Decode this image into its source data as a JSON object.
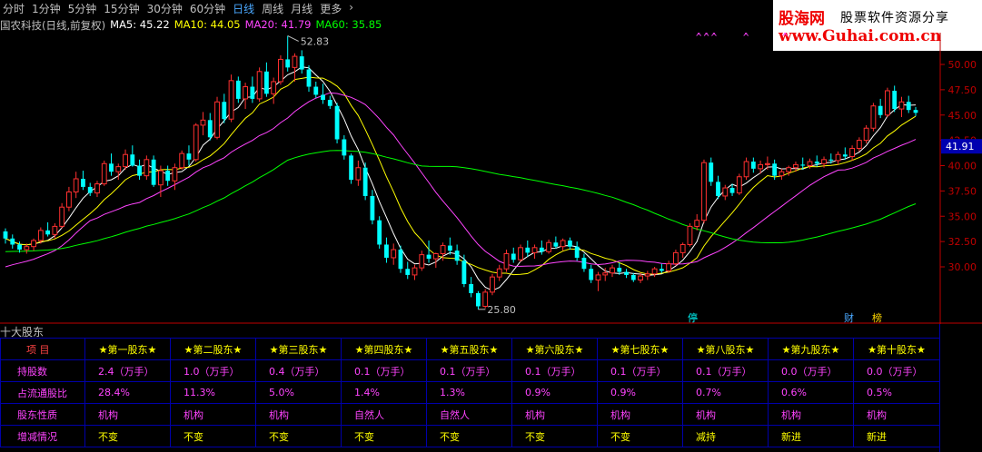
{
  "tabs": [
    "分时",
    "1分钟",
    "5分钟",
    "15分钟",
    "30分钟",
    "60分钟",
    "日线",
    "周线",
    "月线",
    "更多"
  ],
  "active_tab": "日线",
  "more_arrow": "›",
  "indicator": {
    "title": "国农科技(日线,前复权)",
    "ma": [
      {
        "label": "MA5: 45.22",
        "color": "#ffffff"
      },
      {
        "label": "MA10: 44.05",
        "color": "#ffff00"
      },
      {
        "label": "MA20: 41.79",
        "color": "#ff44ff"
      },
      {
        "label": "MA60: 35.85",
        "color": "#00ff00"
      }
    ]
  },
  "logo": {
    "line1": "股海网",
    "line1b": "股票软件资源分享",
    "line2": "www.Guhai.com.cn"
  },
  "section_title": "十大股东",
  "holders_table": {
    "header": [
      "项  目",
      "★第一股东★",
      "★第二股东★",
      "★第三股东★",
      "★第四股东★",
      "★第五股东★",
      "★第六股东★",
      "★第七股东★",
      "★第八股东★",
      "★第九股东★",
      "★第十股东★"
    ],
    "rows": [
      {
        "label": "持股数",
        "cells": [
          "2.4（万手）",
          "1.0（万手）",
          "0.4（万手）",
          "0.1（万手）",
          "0.1（万手）",
          "0.1（万手）",
          "0.1（万手）",
          "0.1（万手）",
          "0.0（万手）",
          "0.0（万手）"
        ]
      },
      {
        "label": "占流通股比",
        "cells": [
          "28.4%",
          "11.3%",
          "5.0%",
          "1.4%",
          "1.3%",
          "0.9%",
          "0.9%",
          "0.7%",
          "0.6%",
          "0.5%"
        ]
      },
      {
        "label": "股东性质",
        "cells": [
          "机构",
          "机构",
          "机构",
          "自然人",
          "自然人",
          "机构",
          "机构",
          "机构",
          "机构",
          "机构"
        ]
      },
      {
        "label": "增减情况",
        "cells": [
          "不变",
          "不变",
          "不变",
          "不变",
          "不变",
          "不变",
          "不变",
          "减持",
          "新进",
          "新进"
        ]
      }
    ]
  },
  "chart_data": {
    "type": "candlestick",
    "ylim": [
      25,
      53
    ],
    "y_ticks": [
      "50.00",
      "47.50",
      "45.00",
      "42.50",
      "40.00",
      "37.50",
      "35.00",
      "32.50",
      "30.00"
    ],
    "y_tick_values": [
      50,
      47.5,
      45,
      42.5,
      40,
      37.5,
      35,
      32.5,
      30
    ],
    "current_price": "41.91",
    "current_price_value": 41.91,
    "annotations": {
      "high_label": "52.83",
      "high_value": 52.83,
      "low_label": "25.80",
      "low_value": 25.8
    },
    "markers": {
      "top_marks": [
        "××× ",
        "×",
        "×"
      ],
      "bottom_marks": [
        "停",
        "财",
        "榜"
      ]
    },
    "ohlc": [
      [
        33.5,
        33.8,
        32.3,
        32.8
      ],
      [
        32.8,
        33.2,
        31.8,
        32.2
      ],
      [
        32.2,
        32.5,
        31.4,
        31.7
      ],
      [
        31.7,
        32.3,
        31.3,
        32.0
      ],
      [
        32.0,
        32.8,
        31.6,
        32.6
      ],
      [
        32.6,
        33.9,
        32.3,
        33.6
      ],
      [
        33.6,
        34.4,
        33.0,
        33.2
      ],
      [
        33.2,
        34.3,
        32.8,
        34.0
      ],
      [
        34.0,
        36.3,
        33.8,
        35.9
      ],
      [
        35.9,
        37.9,
        35.5,
        37.4
      ],
      [
        37.4,
        39.4,
        36.8,
        38.7
      ],
      [
        38.7,
        39.5,
        37.6,
        37.9
      ],
      [
        37.9,
        38.3,
        37.0,
        37.3
      ],
      [
        37.3,
        38.5,
        36.9,
        38.2
      ],
      [
        38.2,
        40.5,
        38.0,
        40.2
      ],
      [
        40.2,
        41.2,
        39.0,
        39.4
      ],
      [
        39.4,
        40.2,
        38.6,
        39.9
      ],
      [
        39.9,
        41.6,
        39.6,
        41.1
      ],
      [
        41.1,
        42.0,
        39.9,
        40.0
      ],
      [
        40.0,
        40.6,
        38.6,
        39.0
      ],
      [
        39.0,
        41.0,
        38.6,
        40.6
      ],
      [
        40.6,
        41.0,
        37.9,
        38.1
      ],
      [
        38.1,
        40.0,
        36.9,
        39.5
      ],
      [
        39.5,
        40.0,
        38.0,
        38.5
      ],
      [
        38.5,
        40.2,
        37.6,
        39.8
      ],
      [
        39.8,
        41.5,
        39.6,
        41.2
      ],
      [
        41.2,
        42.0,
        40.0,
        40.6
      ],
      [
        40.6,
        44.2,
        40.4,
        44.0
      ],
      [
        44.0,
        45.3,
        43.0,
        44.5
      ],
      [
        44.5,
        45.2,
        42.5,
        42.8
      ],
      [
        42.8,
        46.8,
        42.6,
        46.3
      ],
      [
        46.3,
        47.1,
        44.2,
        44.6
      ],
      [
        44.6,
        49.0,
        44.3,
        48.4
      ],
      [
        48.4,
        48.8,
        46.2,
        46.6
      ],
      [
        46.6,
        48.2,
        45.6,
        47.8
      ],
      [
        47.8,
        48.8,
        46.2,
        46.6
      ],
      [
        46.6,
        49.7,
        46.3,
        49.3
      ],
      [
        49.3,
        50.2,
        46.8,
        47.1
      ],
      [
        47.1,
        48.7,
        46.1,
        48.3
      ],
      [
        48.3,
        50.9,
        48.0,
        50.5
      ],
      [
        50.5,
        52.83,
        49.3,
        49.7
      ],
      [
        49.7,
        51.1,
        48.3,
        50.8
      ],
      [
        50.8,
        51.4,
        49.1,
        49.5
      ],
      [
        49.5,
        49.9,
        47.3,
        47.8
      ],
      [
        47.8,
        48.3,
        46.7,
        47.0
      ],
      [
        47.0,
        48.1,
        46.1,
        46.5
      ],
      [
        46.5,
        46.9,
        45.6,
        45.9
      ],
      [
        45.9,
        46.2,
        42.2,
        42.6
      ],
      [
        42.6,
        43.0,
        40.6,
        41.0
      ],
      [
        41.0,
        41.2,
        38.2,
        38.6
      ],
      [
        38.6,
        40.5,
        38.0,
        39.8
      ],
      [
        39.8,
        40.3,
        36.6,
        37.0
      ],
      [
        37.0,
        37.6,
        34.2,
        34.6
      ],
      [
        34.6,
        35.0,
        31.8,
        32.2
      ],
      [
        32.2,
        32.9,
        30.4,
        30.9
      ],
      [
        30.9,
        32.3,
        30.2,
        31.7
      ],
      [
        31.7,
        32.1,
        29.4,
        29.8
      ],
      [
        29.8,
        30.5,
        28.8,
        29.2
      ],
      [
        29.2,
        30.2,
        28.7,
        29.9
      ],
      [
        29.9,
        31.6,
        29.6,
        31.2
      ],
      [
        31.2,
        32.6,
        30.4,
        30.8
      ],
      [
        30.8,
        31.4,
        29.9,
        31.3
      ],
      [
        31.3,
        32.4,
        30.6,
        32.1
      ],
      [
        32.1,
        32.9,
        31.2,
        31.6
      ],
      [
        31.6,
        32.2,
        30.2,
        30.6
      ],
      [
        30.6,
        31.2,
        28.0,
        28.3
      ],
      [
        28.3,
        29.0,
        27.0,
        27.4
      ],
      [
        27.4,
        27.6,
        25.8,
        26.1
      ],
      [
        26.1,
        27.8,
        25.9,
        27.5
      ],
      [
        27.5,
        29.3,
        27.2,
        29.0
      ],
      [
        29.0,
        30.2,
        28.6,
        29.8
      ],
      [
        29.8,
        31.7,
        29.5,
        31.3
      ],
      [
        31.3,
        31.9,
        30.4,
        30.7
      ],
      [
        30.7,
        32.2,
        30.5,
        31.9
      ],
      [
        31.9,
        32.6,
        31.0,
        31.4
      ],
      [
        31.4,
        32.2,
        30.8,
        31.9
      ],
      [
        31.9,
        32.6,
        31.2,
        31.5
      ],
      [
        31.5,
        32.7,
        31.3,
        32.4
      ],
      [
        32.4,
        33.0,
        31.8,
        32.0
      ],
      [
        32.0,
        32.8,
        31.6,
        32.6
      ],
      [
        32.6,
        32.9,
        31.7,
        32.0
      ],
      [
        32.0,
        32.5,
        30.6,
        30.9
      ],
      [
        30.9,
        31.3,
        29.5,
        29.8
      ],
      [
        29.8,
        30.2,
        28.4,
        28.7
      ],
      [
        28.7,
        29.5,
        27.6,
        29.2
      ],
      [
        29.2,
        29.9,
        28.6,
        29.4
      ],
      [
        29.4,
        30.2,
        29.0,
        29.9
      ],
      [
        29.9,
        30.4,
        29.2,
        29.5
      ],
      [
        29.5,
        29.8,
        28.9,
        29.2
      ],
      [
        29.2,
        29.4,
        28.5,
        28.7
      ],
      [
        28.7,
        29.4,
        28.4,
        29.1
      ],
      [
        29.1,
        29.6,
        28.7,
        29.3
      ],
      [
        29.3,
        30.0,
        29.0,
        29.8
      ],
      [
        29.8,
        30.3,
        29.4,
        29.6
      ],
      [
        29.6,
        30.6,
        29.4,
        30.3
      ],
      [
        30.3,
        31.7,
        30.1,
        31.4
      ],
      [
        31.4,
        32.4,
        30.9,
        32.2
      ],
      [
        32.2,
        34.3,
        32.0,
        34.0
      ],
      [
        34.0,
        35.2,
        33.6,
        34.6
      ],
      [
        34.6,
        40.6,
        34.3,
        40.3
      ],
      [
        40.3,
        40.8,
        38.0,
        38.4
      ],
      [
        38.4,
        39.0,
        36.7,
        37.0
      ],
      [
        37.0,
        38.1,
        36.6,
        37.8
      ],
      [
        37.8,
        38.2,
        37.0,
        37.3
      ],
      [
        37.3,
        39.2,
        37.1,
        38.9
      ],
      [
        38.9,
        40.8,
        38.6,
        40.4
      ],
      [
        40.4,
        40.8,
        39.3,
        39.7
      ],
      [
        39.7,
        40.5,
        39.2,
        40.1
      ],
      [
        40.1,
        40.9,
        39.6,
        40.2
      ],
      [
        40.2,
        40.6,
        38.6,
        39.0
      ],
      [
        39.0,
        39.7,
        38.6,
        39.4
      ],
      [
        39.4,
        40.0,
        39.0,
        39.8
      ],
      [
        39.8,
        40.4,
        39.4,
        40.1
      ],
      [
        40.1,
        40.8,
        39.6,
        40.0
      ],
      [
        40.0,
        40.7,
        39.7,
        40.4
      ],
      [
        40.4,
        41.0,
        39.9,
        40.2
      ],
      [
        40.2,
        40.9,
        39.8,
        40.6
      ],
      [
        40.6,
        41.2,
        40.2,
        40.5
      ],
      [
        40.5,
        41.4,
        40.1,
        41.1
      ],
      [
        41.1,
        41.8,
        40.6,
        40.9
      ],
      [
        40.9,
        42.0,
        40.5,
        41.7
      ],
      [
        41.7,
        42.8,
        41.4,
        42.5
      ],
      [
        42.5,
        44.0,
        42.2,
        43.7
      ],
      [
        43.7,
        46.2,
        43.4,
        45.9
      ],
      [
        45.9,
        46.6,
        44.7,
        45.0
      ],
      [
        45.0,
        47.7,
        44.8,
        47.4
      ],
      [
        47.4,
        47.9,
        45.3,
        45.6
      ],
      [
        45.6,
        46.8,
        44.8,
        46.3
      ],
      [
        46.3,
        46.9,
        45.2,
        45.5
      ],
      [
        45.5,
        45.8,
        44.9,
        45.22
      ]
    ],
    "ma_series": [
      {
        "name": "MA5",
        "color": "#ffffff",
        "values": []
      },
      {
        "name": "MA10",
        "color": "#ffff00",
        "values": []
      },
      {
        "name": "MA20",
        "color": "#ff44ff",
        "values": []
      },
      {
        "name": "MA60",
        "color": "#00ff00",
        "values": []
      }
    ],
    "colors": {
      "up": "#ff3030",
      "down": "#00ffff",
      "axis": "#c00000",
      "grid": "#000000"
    }
  }
}
